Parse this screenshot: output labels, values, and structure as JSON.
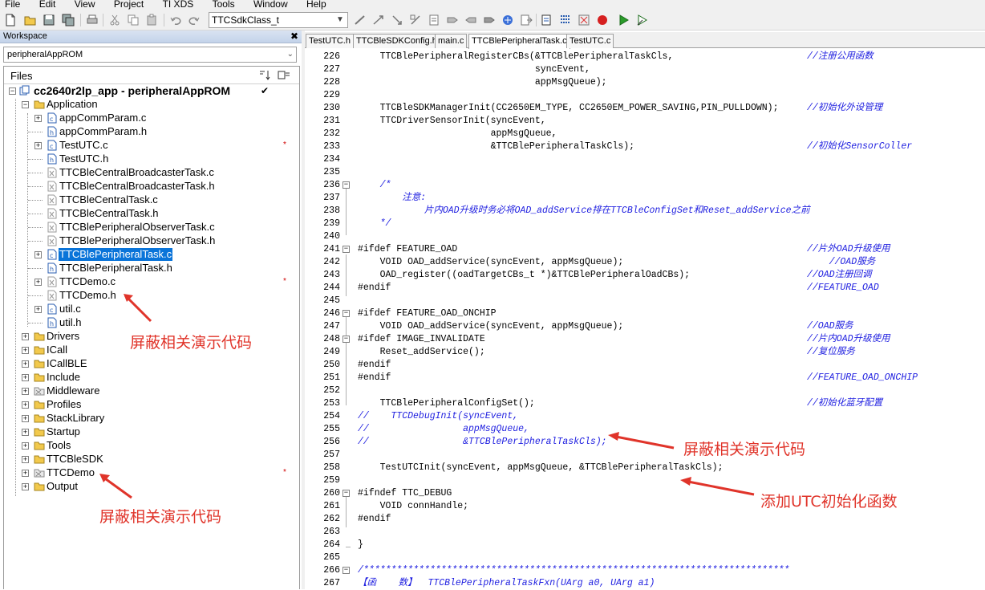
{
  "menu": [
    "File",
    "Edit",
    "View",
    "Project",
    "TI XDS",
    "Tools",
    "Window",
    "Help"
  ],
  "toolbar": {
    "combo_value": "TTCSdkClass_t"
  },
  "workspace": {
    "title": "Workspace",
    "config": "peripheralAppROM",
    "files_label": "Files",
    "project": "cc2640r2lp_app - peripheralAppROM",
    "tree": [
      {
        "name": "Application",
        "type": "folder"
      },
      {
        "name": "appCommParam.c",
        "type": "c"
      },
      {
        "name": "appCommParam.h",
        "type": "h"
      },
      {
        "name": "TestUTC.c",
        "type": "c",
        "mark": "*"
      },
      {
        "name": "TestUTC.h",
        "type": "h"
      },
      {
        "name": "TTCBleCentralBroadcasterTask.c",
        "type": "x"
      },
      {
        "name": "TTCBleCentralBroadcasterTask.h",
        "type": "x"
      },
      {
        "name": "TTCBleCentralTask.c",
        "type": "x"
      },
      {
        "name": "TTCBleCentralTask.h",
        "type": "x"
      },
      {
        "name": "TTCBlePeripheralObserverTask.c",
        "type": "x"
      },
      {
        "name": "TTCBlePeripheralObserverTask.h",
        "type": "x"
      },
      {
        "name": "TTCBlePeripheralTask.c",
        "type": "c",
        "selected": true
      },
      {
        "name": "TTCBlePeripheralTask.h",
        "type": "h"
      },
      {
        "name": "TTCDemo.c",
        "type": "x",
        "mark": "*"
      },
      {
        "name": "TTCDemo.h",
        "type": "x"
      },
      {
        "name": "util.c",
        "type": "c"
      },
      {
        "name": "util.h",
        "type": "h"
      },
      {
        "name": "Drivers",
        "type": "folder"
      },
      {
        "name": "ICall",
        "type": "folder"
      },
      {
        "name": "ICallBLE",
        "type": "folder"
      },
      {
        "name": "Include",
        "type": "folder"
      },
      {
        "name": "Middleware",
        "type": "xfolder"
      },
      {
        "name": "Profiles",
        "type": "folder"
      },
      {
        "name": "StackLibrary",
        "type": "folder"
      },
      {
        "name": "Startup",
        "type": "folder"
      },
      {
        "name": "Tools",
        "type": "folder"
      },
      {
        "name": "TTCBleSDK",
        "type": "folder"
      },
      {
        "name": "TTCDemo",
        "type": "xfolder",
        "mark": "*"
      },
      {
        "name": "Output",
        "type": "folder"
      }
    ]
  },
  "annotations": {
    "left_top": "屏蔽相关演示代码",
    "left_bottom": "屏蔽相关演示代码",
    "right_top": "屏蔽相关演示代码",
    "right_bottom": "添加UTC初始化函数"
  },
  "tabs": [
    "TestUTC.h",
    "TTCBleSDKConfig.h",
    "main.c",
    "TTCBlePeripheralTask.c",
    "TestUTC.c"
  ],
  "active_tab": 3,
  "code": [
    {
      "n": "226",
      "t": "    TTCBlePeripheralRegisterCBs(&TTCBlePeripheralTaskCls,",
      "c": "//注册公用函数"
    },
    {
      "n": "227",
      "t": "                                syncEvent,",
      "c": ""
    },
    {
      "n": "228",
      "t": "                                appMsgQueue);",
      "c": ""
    },
    {
      "n": "229",
      "t": "",
      "c": ""
    },
    {
      "n": "230",
      "t": "    TTCBleSDKManagerInit(CC2650EM_TYPE, CC2650EM_POWER_SAVING,PIN_PULLDOWN);",
      "c": "//初始化外设管理"
    },
    {
      "n": "231",
      "t": "    TTCDriverSensorInit(syncEvent,",
      "c": ""
    },
    {
      "n": "232",
      "t": "                        appMsgQueue,",
      "c": ""
    },
    {
      "n": "233",
      "t": "                        &TTCBlePeripheralTaskCls);",
      "c": "//初始化SensorColler"
    },
    {
      "n": "234",
      "t": "",
      "c": ""
    },
    {
      "n": "235",
      "t": "",
      "c": ""
    },
    {
      "n": "236",
      "t": "    /*",
      "c": "",
      "fold": true
    },
    {
      "n": "237",
      "t": "        注意:",
      "c": ""
    },
    {
      "n": "238",
      "t": "            片内OAD升级时务必将OAD_addService排在TTCBleConfigSet和Reset_addService之前",
      "c": ""
    },
    {
      "n": "239",
      "t": "    */",
      "c": ""
    },
    {
      "n": "240",
      "t": "",
      "c": ""
    },
    {
      "n": "241",
      "t": "#ifdef FEATURE_OAD",
      "c": "//片外OAD升级使用",
      "fold": true
    },
    {
      "n": "242",
      "t": "    VOID OAD_addService(syncEvent, appMsgQueue);",
      "c": "    //OAD服务"
    },
    {
      "n": "243",
      "t": "    OAD_register((oadTargetCBs_t *)&TTCBlePeripheralOadCBs);",
      "c": "//OAD注册回调"
    },
    {
      "n": "244",
      "t": "#endif",
      "c": "//FEATURE_OAD"
    },
    {
      "n": "245",
      "t": "",
      "c": ""
    },
    {
      "n": "246",
      "t": "#ifdef FEATURE_OAD_ONCHIP",
      "c": "",
      "fold": true
    },
    {
      "n": "247",
      "t": "    VOID OAD_addService(syncEvent, appMsgQueue);",
      "c": "//OAD服务"
    },
    {
      "n": "248",
      "t": "#ifdef IMAGE_INVALIDATE",
      "c": "//片内OAD升级使用",
      "fold": true
    },
    {
      "n": "249",
      "t": "    Reset_addService();",
      "c": "//复位服务"
    },
    {
      "n": "250",
      "t": "#endif",
      "c": ""
    },
    {
      "n": "251",
      "t": "#endif",
      "c": "//FEATURE_OAD_ONCHIP"
    },
    {
      "n": "252",
      "t": "",
      "c": ""
    },
    {
      "n": "253",
      "t": "    TTCBlePeripheralConfigSet();",
      "c": "//初始化蓝牙配置"
    },
    {
      "n": "254",
      "t": "//    TTCDebugInit(syncEvent,",
      "c": ""
    },
    {
      "n": "255",
      "t": "//                 appMsgQueue,",
      "c": ""
    },
    {
      "n": "256",
      "t": "//                 &TTCBlePeripheralTaskCls);",
      "c": ""
    },
    {
      "n": "257",
      "t": "",
      "c": ""
    },
    {
      "n": "258",
      "t": "    TestUTCInit(syncEvent, appMsgQueue, &TTCBlePeripheralTaskCls);",
      "c": ""
    },
    {
      "n": "259",
      "t": "",
      "c": ""
    },
    {
      "n": "260",
      "t": "#ifndef TTC_DEBUG",
      "c": "",
      "fold": true
    },
    {
      "n": "261",
      "t": "    VOID connHandle;",
      "c": ""
    },
    {
      "n": "262",
      "t": "#endif",
      "c": ""
    },
    {
      "n": "263",
      "t": "",
      "c": ""
    },
    {
      "n": "264",
      "t": "}",
      "c": ""
    },
    {
      "n": "265",
      "t": "",
      "c": ""
    },
    {
      "n": "266",
      "t": "/*****************************************************************************",
      "c": "",
      "fold": true
    },
    {
      "n": "267",
      "t": "【函    数】  TTCBlePeripheralTaskFxn(UArg a0, UArg a1)",
      "c": ""
    }
  ]
}
